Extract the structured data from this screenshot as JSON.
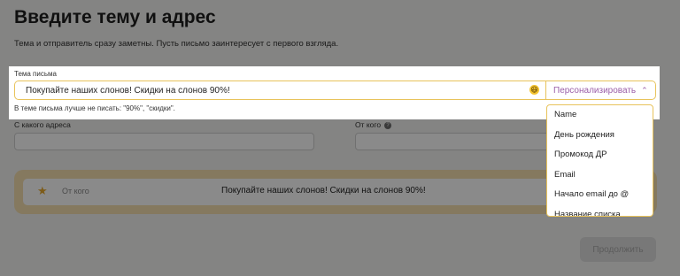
{
  "page": {
    "title": "Введите тему и адрес",
    "subtitle": "Тема и отправитель сразу заметны. Пусть письмо заинтересует с первого взгляда."
  },
  "subject": {
    "label": "Тема письма",
    "value": "Покупайте наших слонов! Скидки на слонов 90%!",
    "emoji": "😃",
    "personalize_label": "Персонализировать",
    "hint": "В теме письма лучше не писать: \"90%\", \"скидки\"."
  },
  "from_address": {
    "label": "С какого адреса"
  },
  "from_name": {
    "label": "От кого"
  },
  "preview": {
    "from": "От кого",
    "subject": "Покупайте наших слонов! Скидки на слонов 90%!"
  },
  "personalize_menu": {
    "items": [
      "Name",
      "День рождения",
      "Промокод ДР",
      "Email",
      "Начало email до @",
      "Название списка"
    ]
  },
  "buttons": {
    "next": "Продолжить"
  },
  "colors": {
    "accent_border": "#e8c35b",
    "personalize_text": "#9b5ea8",
    "preview_frame": "#f5dfb0",
    "star": "#e7a92d"
  }
}
